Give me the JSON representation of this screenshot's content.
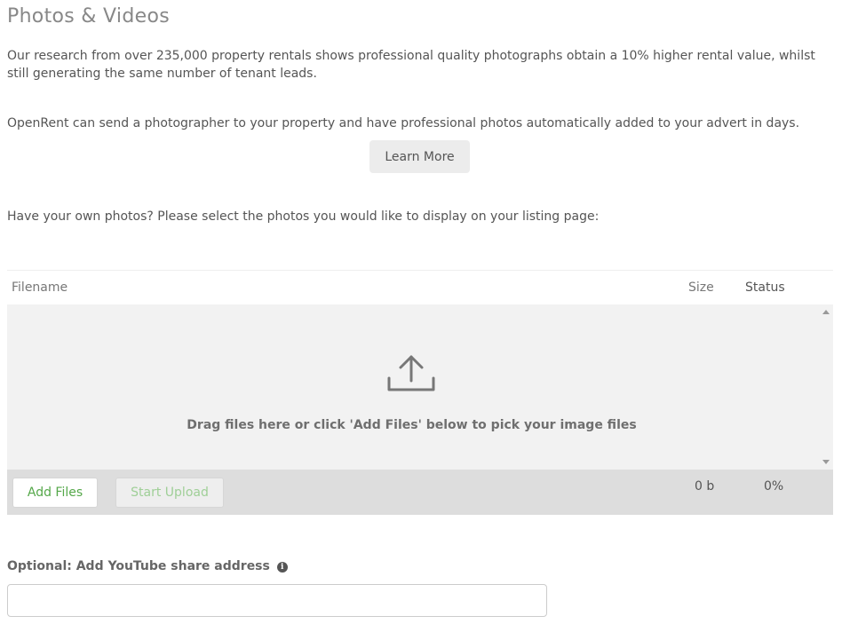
{
  "page": {
    "title": "Photos & Videos",
    "intro": "Our research from over 235,000 property rentals shows professional quality photographs obtain a 10% higher rental value, whilst still generating the same number of tenant leads.",
    "photographer_text": "OpenRent can send a photographer to your property and have professional photos automatically added to your advert in days.",
    "learn_more_label": "Learn More",
    "own_photos_text": "Have your own photos? Please select the photos you would like to display on your listing page:"
  },
  "uploader": {
    "columns": {
      "filename": "Filename",
      "size": "Size",
      "status": "Status"
    },
    "drop_text": "Drag files here or click 'Add Files' below to pick your image files",
    "upload_icon": "upload-icon",
    "add_files_label": "Add Files",
    "start_upload_label": "Start Upload",
    "total_size": "0 b",
    "total_status": "0%"
  },
  "youtube": {
    "label": "Optional: Add YouTube share address",
    "info_icon": "info-icon",
    "info_glyph": "i",
    "value": "",
    "placeholder": ""
  },
  "colors": {
    "accent_green": "#55a84a",
    "dropzone_bg": "#f2f2f2",
    "footer_bg": "#dddddd",
    "button_bg": "#ececec"
  }
}
